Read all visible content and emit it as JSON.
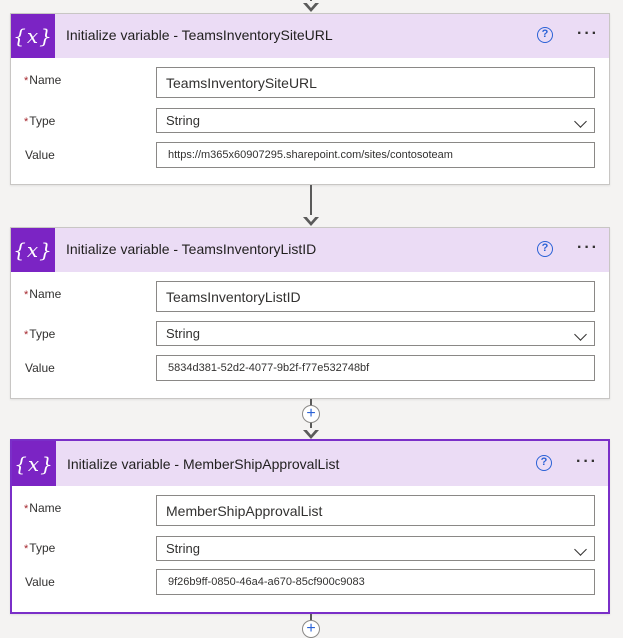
{
  "cards": [
    {
      "title": "Initialize variable - TeamsInventorySiteURL",
      "icon_text": "{x}",
      "name_label": "Name",
      "type_label": "Type",
      "value_label": "Value",
      "name_value": "TeamsInventorySiteURL",
      "type_value": "String",
      "value": "https://m365x60907295.sharepoint.com/sites/contosoteam"
    },
    {
      "title": "Initialize variable - TeamsInventoryListID",
      "icon_text": "{x}",
      "name_label": "Name",
      "type_label": "Type",
      "value_label": "Value",
      "name_value": "TeamsInventoryListID",
      "type_value": "String",
      "value": "5834d381-52d2-4077-9b2f-f77e532748bf"
    },
    {
      "title": "Initialize variable - MemberShipApprovalList",
      "icon_text": "{x}",
      "name_label": "Name",
      "type_label": "Type",
      "value_label": "Value",
      "name_value": "MemberShipApprovalList",
      "type_value": "String",
      "value": "9f26b9ff-0850-46a4-a670-85cf900c9083"
    }
  ],
  "help_glyph": "?",
  "more_glyph": "···",
  "plus_glyph": "+",
  "required_marker": "*",
  "colors": {
    "header_bg": "#ebdcf5",
    "icon_bg": "#7b24c4",
    "selected_border": "#7a2fc8",
    "link_blue": "#2b62d6",
    "required_red": "#a4262c"
  }
}
